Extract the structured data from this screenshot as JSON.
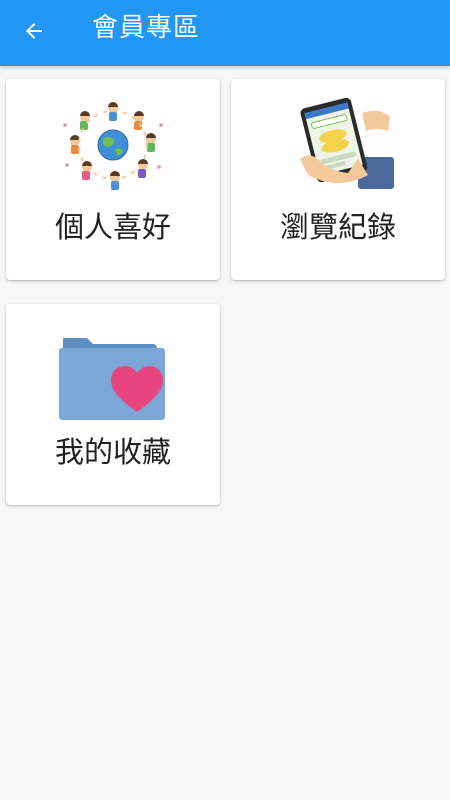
{
  "appbar": {
    "title": "會員專區",
    "back_icon": "arrow-left-icon",
    "background": "#2196f3"
  },
  "cards": [
    {
      "label": "個人喜好",
      "icon": "people-around-globe-illustration"
    },
    {
      "label": "瀏覽紀錄",
      "icon": "tablet-in-hand-illustration"
    },
    {
      "label": "我的收藏",
      "icon": "folder-with-heart-illustration"
    }
  ]
}
